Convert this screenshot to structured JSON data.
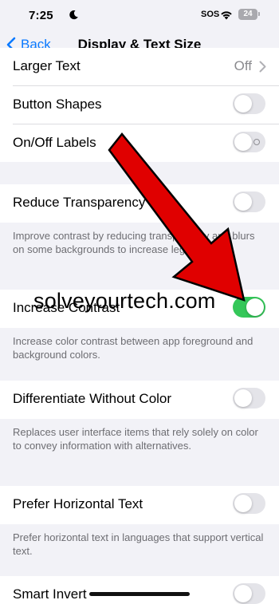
{
  "status_bar": {
    "time": "7:25",
    "sos": "SOS",
    "battery": "24"
  },
  "nav": {
    "back_label": "Back",
    "title": "Display & Text Size"
  },
  "rows": {
    "larger_text": {
      "label": "Larger Text",
      "value": "Off"
    },
    "button_shapes": {
      "label": "Button Shapes",
      "on": false
    },
    "on_off_labels": {
      "label": "On/Off Labels",
      "on": false
    },
    "reduce_transparency": {
      "label": "Reduce Transparency",
      "on": false,
      "footer": "Improve contrast by reducing transparency and blurs on some backgrounds to increase legibility."
    },
    "increase_contrast": {
      "label": "Increase Contrast",
      "on": true,
      "footer": "Increase color contrast between app foreground and background colors."
    },
    "differentiate": {
      "label": "Differentiate Without Color",
      "on": false,
      "footer": "Replaces user interface items that rely solely on color to convey information with alternatives."
    },
    "horizontal_text": {
      "label": "Prefer Horizontal Text",
      "on": false,
      "footer": "Prefer horizontal text in languages that support vertical text."
    },
    "smart_invert": {
      "label": "Smart Invert",
      "on": false
    }
  },
  "watermark": "solveyourtech.com",
  "colors": {
    "accent": "#0a7aff",
    "toggle_on": "#34c759",
    "toggle_off": "#e4e4e9",
    "arrow": "#e00000"
  }
}
